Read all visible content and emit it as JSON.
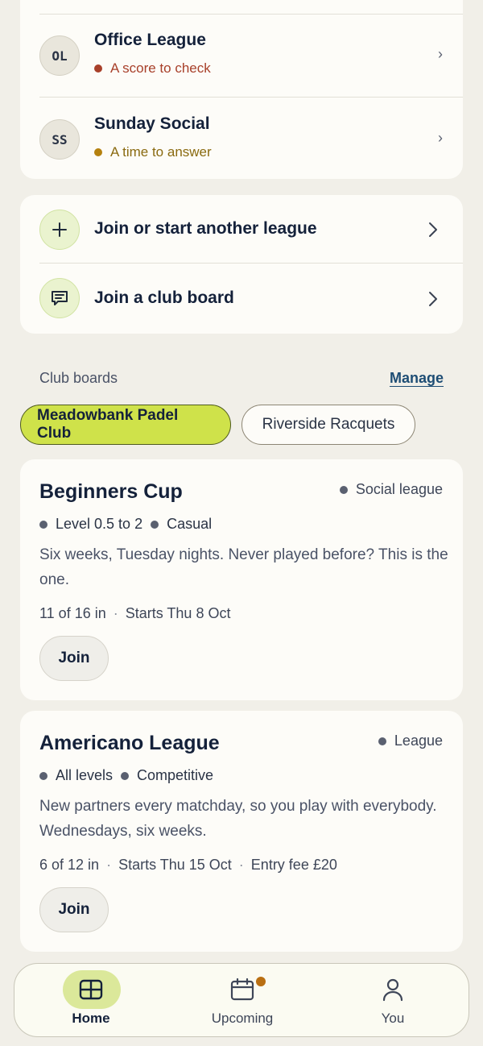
{
  "my_leagues": [
    {
      "initials": "OL",
      "name": "Office League",
      "status": "A score to check",
      "status_color": "#a8402a"
    },
    {
      "initials": "SS",
      "name": "Sunday Social",
      "status": "A time to answer",
      "status_color": "#8a6a10"
    }
  ],
  "actions": [
    {
      "label": "Join or start another league",
      "icon": "plus-icon"
    },
    {
      "label": "Join a club board",
      "icon": "chat-board-icon"
    }
  ],
  "club_boards": {
    "title": "Club boards",
    "manage_label": "Manage",
    "chips": [
      "Meadowbank Padel Club",
      "Riverside Racquets"
    ],
    "active_chip": "Meadowbank Padel Club"
  },
  "listings": [
    {
      "title": "Beginners Cup",
      "type": "Social league",
      "tags": [
        "Level 0.5 to 2",
        "Casual"
      ],
      "description": "Six weeks, Tuesday nights. Never played before? This is the one.",
      "meta": [
        "11 of 16 in",
        "Starts Thu 8 Oct"
      ],
      "join_label": "Join"
    },
    {
      "title": "Americano League",
      "type": "League",
      "tags": [
        "All levels",
        "Competitive"
      ],
      "description": "New partners every matchday, so you play with everybody. Wednesdays, six weeks.",
      "meta": [
        "6 of 12 in",
        "Starts Thu 15 Oct",
        "Entry fee £20"
      ],
      "join_label": "Join"
    }
  ],
  "tabbar": {
    "tabs": [
      {
        "label": "Home",
        "icon": "grid-home-icon",
        "active": true
      },
      {
        "label": "Upcoming",
        "icon": "calendar-icon",
        "active": false,
        "badge": true
      },
      {
        "label": "You",
        "icon": "person-icon",
        "active": false
      }
    ]
  },
  "colors": {
    "accent": "#cfe24a",
    "background": "#f1efe8",
    "card": "#fdfcf8",
    "badge": "#b96f12"
  }
}
